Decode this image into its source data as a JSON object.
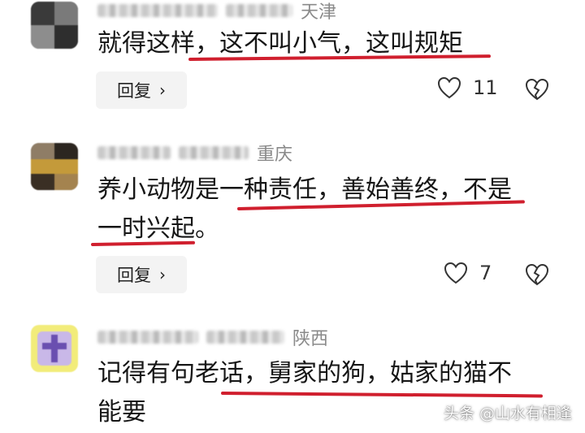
{
  "comments": [
    {
      "location": "天津",
      "text_lines": [
        "就得这样，这不叫小气，这叫规矩"
      ],
      "reply_label": "回复",
      "reply_chevron": "›",
      "like_count": "11"
    },
    {
      "location": "重庆",
      "text_lines": [
        "养小动物是一种责任，善始善终，不是",
        "一时兴起。"
      ],
      "reply_label": "回复",
      "reply_chevron": "›",
      "like_count": "7"
    },
    {
      "location": "陕西",
      "text_lines": [
        "记得有句老话，舅家的狗，姑家的猫不",
        "能要"
      ]
    }
  ],
  "watermark": "头条 @山水有相逢",
  "colors": {
    "underline": "#d01f2e",
    "reply_bg": "#f3f3f3",
    "location": "#8a8a8a"
  },
  "icons": [
    "avatar",
    "heart-outline-icon",
    "broken-heart-icon",
    "chevron-right-icon"
  ]
}
